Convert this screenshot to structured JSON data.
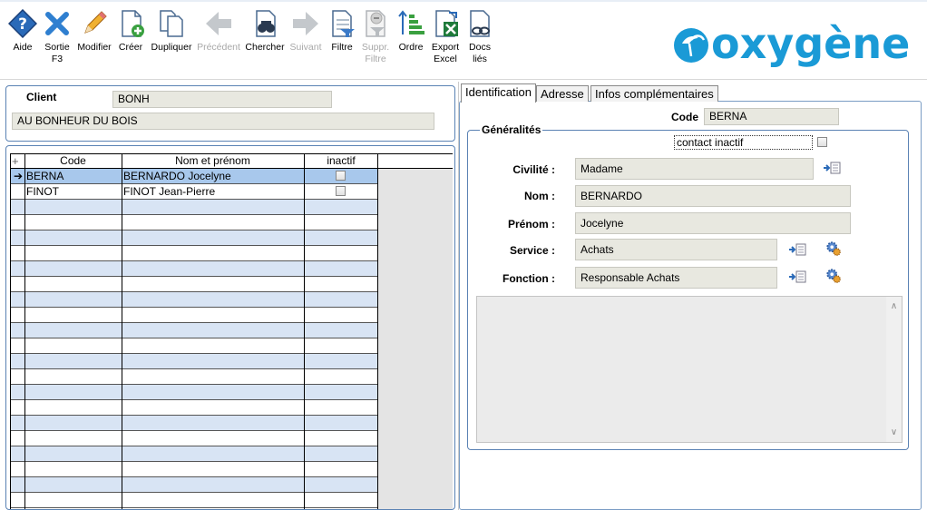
{
  "toolbar": {
    "items": [
      {
        "label": "Aide",
        "icon": "help-icon",
        "enabled": true
      },
      {
        "label": "Sortie F3",
        "icon": "exit-icon",
        "enabled": true
      },
      {
        "label": "Modifier",
        "icon": "pencil-icon",
        "enabled": true
      },
      {
        "label": "Créer",
        "icon": "new-doc-icon",
        "enabled": true
      },
      {
        "label": "Dupliquer",
        "icon": "duplicate-icon",
        "enabled": true
      },
      {
        "label": "Précédent",
        "icon": "arrow-left-icon",
        "enabled": false
      },
      {
        "label": "Chercher",
        "icon": "binoculars-icon",
        "enabled": true
      },
      {
        "label": "Suivant",
        "icon": "arrow-right-icon",
        "enabled": false
      },
      {
        "label": "Filtre",
        "icon": "filter-icon",
        "enabled": true
      },
      {
        "label": "Suppr. Filtre",
        "icon": "remove-filter-icon",
        "enabled": false
      },
      {
        "label": "Ordre",
        "icon": "sort-icon",
        "enabled": true
      },
      {
        "label": "Export Excel",
        "icon": "excel-icon",
        "enabled": true
      },
      {
        "label": "Docs liés",
        "icon": "linked-docs-icon",
        "enabled": true
      }
    ],
    "logo_text": "oxygène",
    "brand_color": "#1a9ad6"
  },
  "client": {
    "label": "Client",
    "code": "BONH",
    "name": "AU BONHEUR DU BOIS"
  },
  "grid": {
    "columns": [
      "Code",
      "Nom et prénom",
      "inactif"
    ],
    "rows": [
      {
        "code": "BERNA",
        "name": "BERNARDO Jocelyne",
        "inactif": false,
        "selected": true
      },
      {
        "code": "FINOT",
        "name": "FINOT Jean-Pierre",
        "inactif": false,
        "selected": false
      }
    ],
    "empty_rows": 20
  },
  "tabs": {
    "items": [
      "Identification",
      "Adresse",
      "Infos complémentaires"
    ],
    "active": 0
  },
  "detail": {
    "code_label": "Code",
    "code_value": "BERNA",
    "group_title": "Généralités",
    "contact_inactive_label": "contact inactif",
    "civilite_label": "Civilité :",
    "civilite_value": "Madame",
    "nom_label": "Nom :",
    "nom_value": "BERNARDO",
    "prenom_label": "Prénom :",
    "prenom_value": "Jocelyne",
    "service_label": "Service :",
    "service_value": "Achats",
    "fonction_label": "Fonction :",
    "fonction_value": "Responsable Achats"
  },
  "colors": {
    "selected_row": "#a8c8ec",
    "alt_row": "#d8e4f4",
    "border_blue": "#5a82b4",
    "field_bg": "#e8e8e0"
  }
}
